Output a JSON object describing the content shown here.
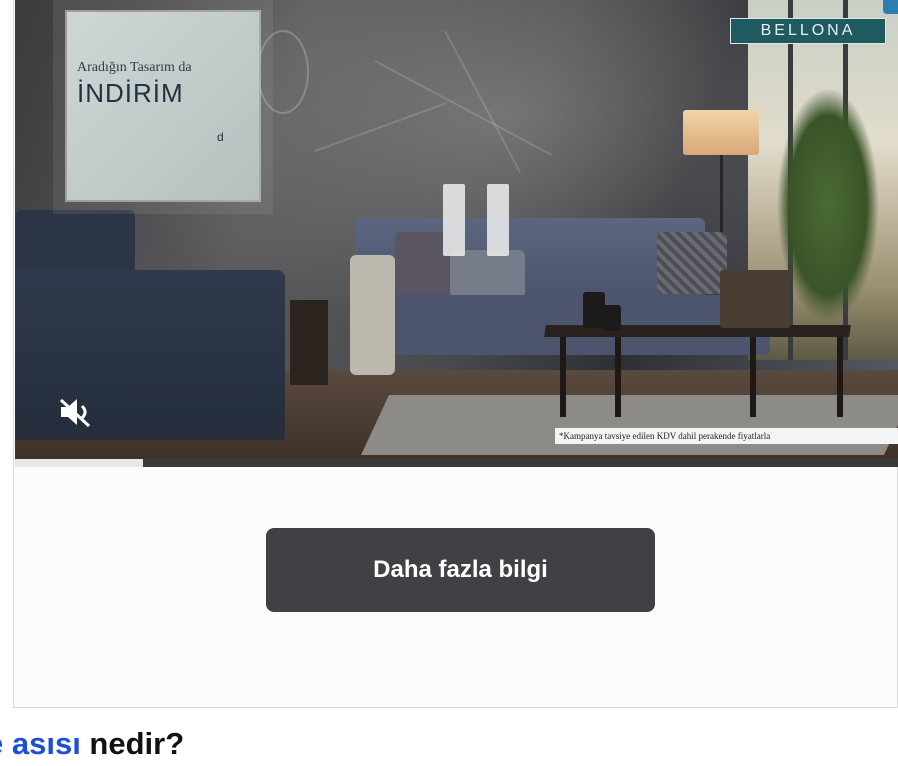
{
  "ad": {
    "promo_overlay": {
      "line1": "Aradığın Tasarım da",
      "line2": "İNDİRİM",
      "fine_mark": "d"
    },
    "brand_name": "BELLONA",
    "disclaimer": "*Kampanya tavsiye edilen KDV dahil perakende fiyatlarla",
    "video_controls": {
      "pause_icon": "pause-icon",
      "mute_icon": "muted-speaker-icon",
      "progress_fraction": 0.145
    },
    "cta_label": "Daha fazla bilgi"
  },
  "page_heading": {
    "link_text": "e asısı",
    "rest_text": " nedir?"
  },
  "colors": {
    "cta_background": "#3f4144",
    "brand_background": "#1e5a5f",
    "link": "#1a4fd6"
  }
}
